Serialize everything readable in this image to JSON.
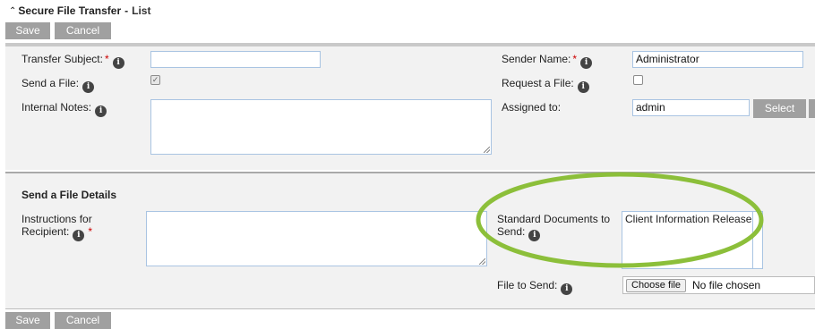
{
  "header": {
    "app_title": "Secure File Transfer",
    "separator": "-",
    "view": "List"
  },
  "toolbar": {
    "save_label": "Save",
    "cancel_label": "Cancel"
  },
  "form": {
    "transfer_subject": {
      "label": "Transfer Subject:",
      "required": "*",
      "value": ""
    },
    "send_a_file": {
      "label": "Send a File:",
      "checked": true,
      "check_glyph": "✓"
    },
    "internal_notes": {
      "label": "Internal Notes:",
      "value": ""
    },
    "sender_name": {
      "label": "Sender Name:",
      "required": "*",
      "value": "Administrator"
    },
    "request_a_file": {
      "label": "Request a File:",
      "checked": false
    },
    "assigned_to": {
      "label": "Assigned to:",
      "value": "admin",
      "select_label": "Select"
    }
  },
  "send_file_details": {
    "title": "Send a File Details",
    "instructions": {
      "label_line1": "Instructions for",
      "label_line2": "Recipient:",
      "required": "*",
      "value": ""
    },
    "standard_documents": {
      "label_line1": "Standard Documents to",
      "label_line2": "Send:",
      "items": [
        "Client Information Release"
      ]
    },
    "file_to_send": {
      "label": "File to Send:",
      "choose_label": "Choose file",
      "status": "No file chosen"
    }
  },
  "info_glyph": "i",
  "colors": {
    "button_bg": "#a0a0a0",
    "highlight_ellipse": "#8cbf3a",
    "required": "#cc0000",
    "input_border": "#a9c4e2"
  }
}
